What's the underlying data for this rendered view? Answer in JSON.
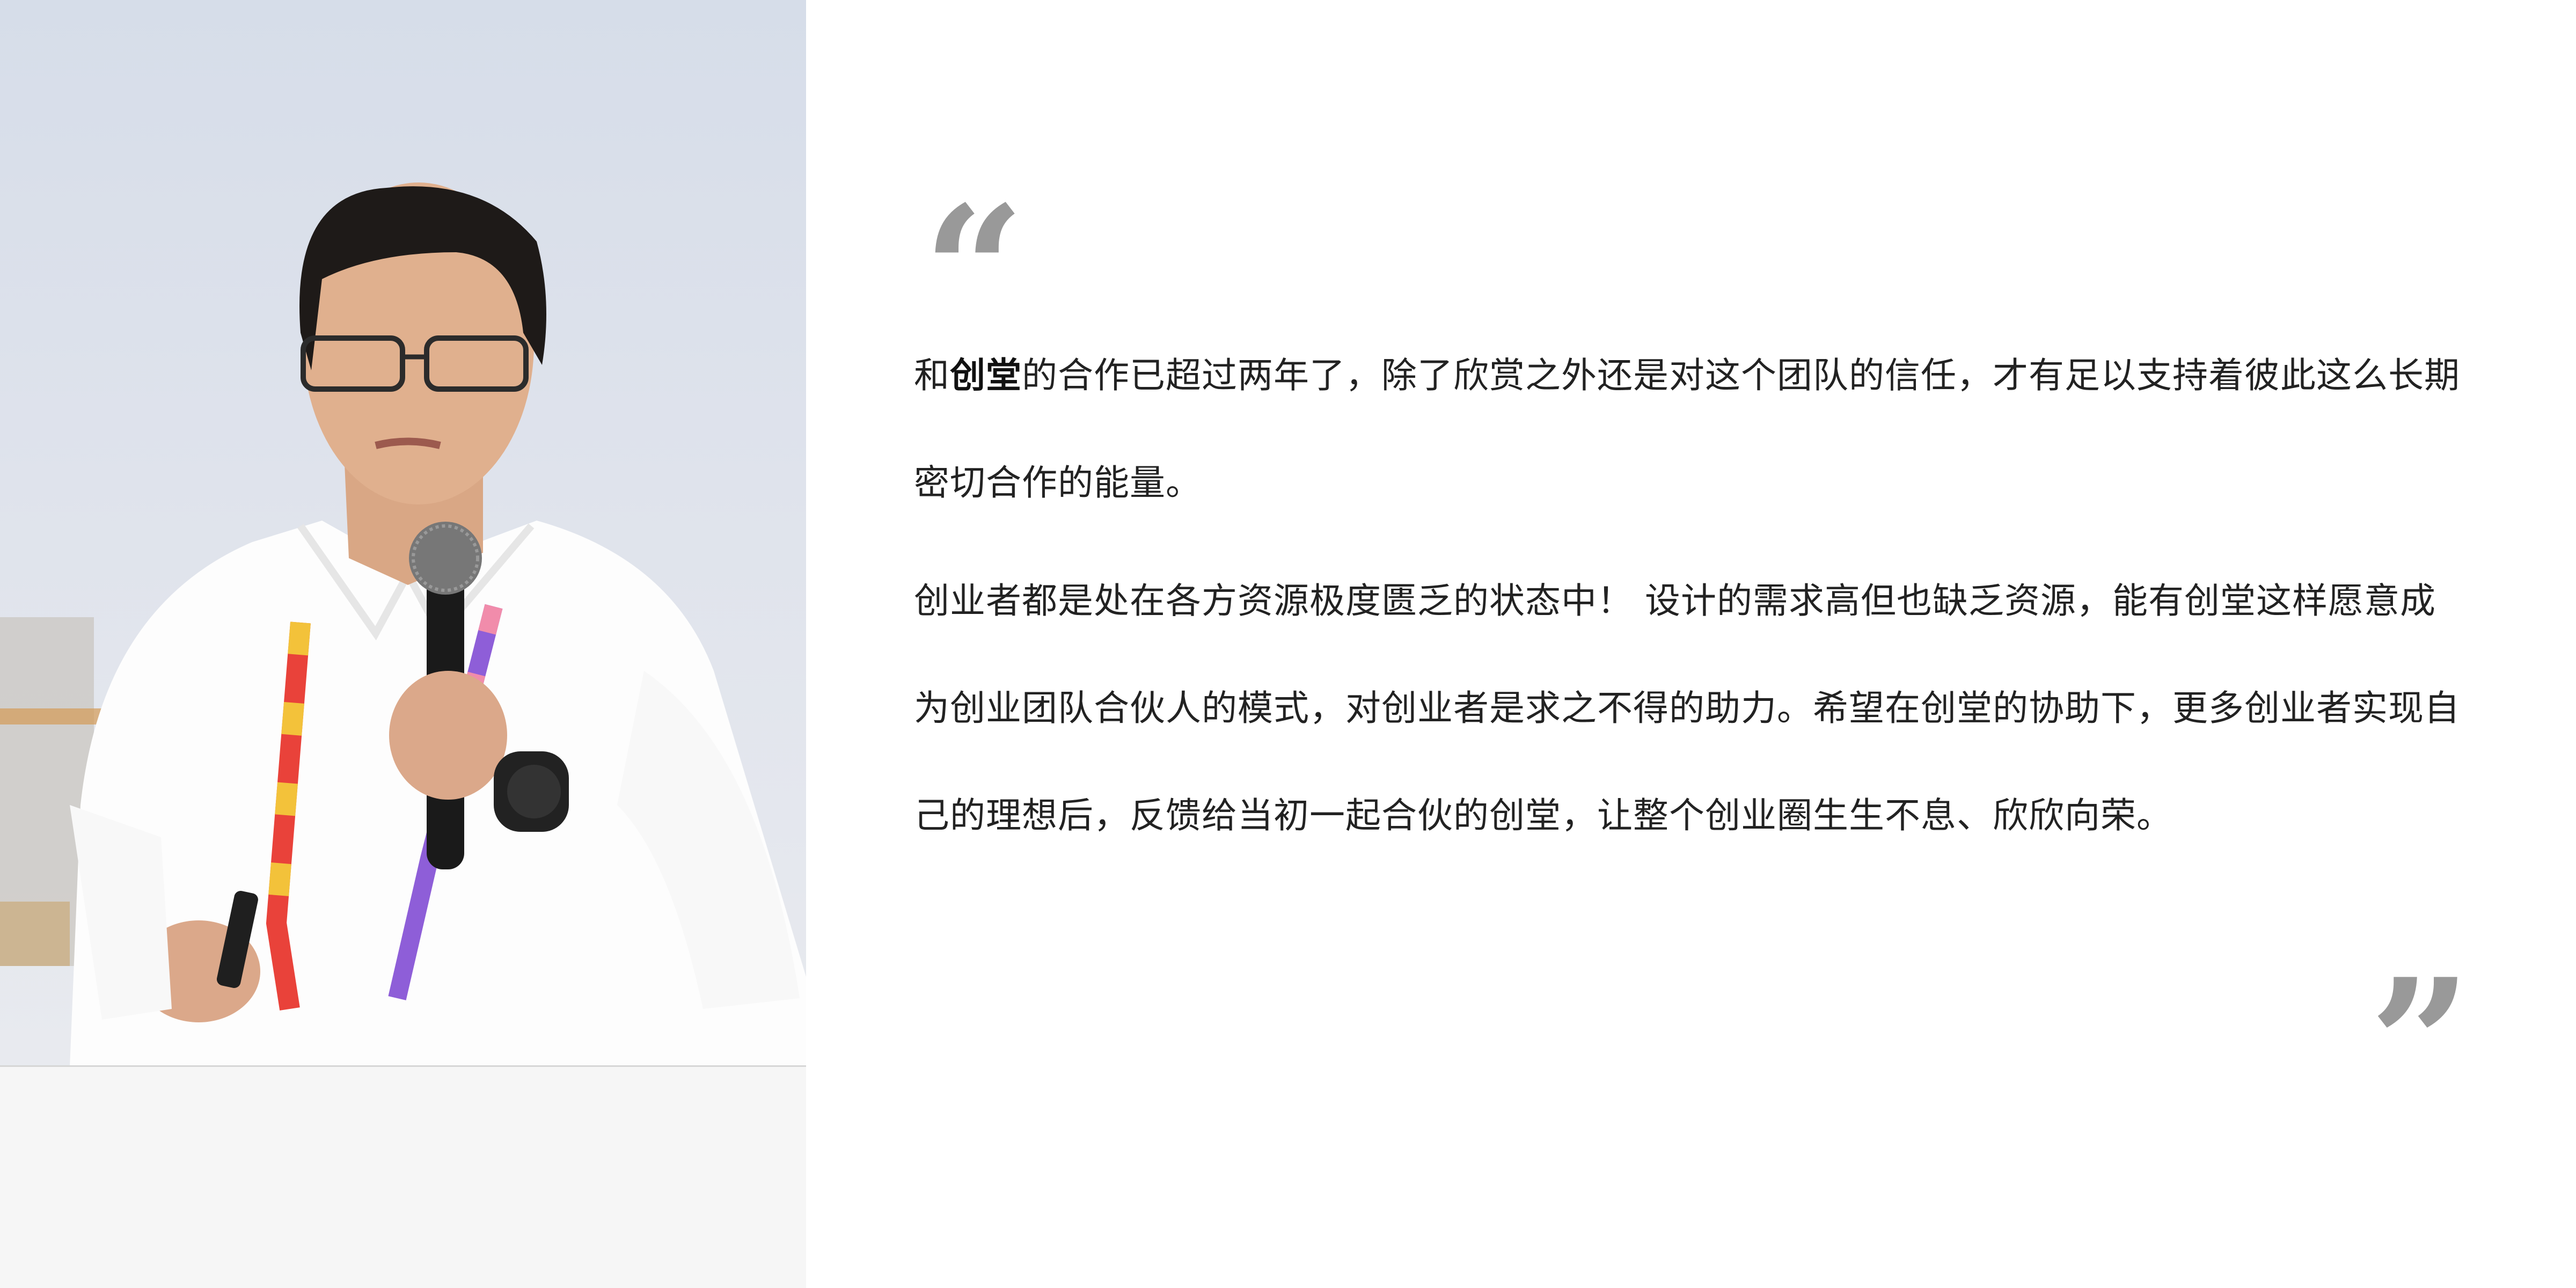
{
  "photo": {
    "alt": "speaker"
  },
  "quote": {
    "open_mark": "“",
    "close_mark": "”",
    "para1_prefix": "和",
    "para1_brand": "创堂",
    "para1_rest": "的合作已超过两年了，除了欣赏之外还是对这个团队的信任，才有足以支持着彼此这么长期密切合作的能量。",
    "para2": "创业者都是处在各方资源极度匮乏的状态中！ 设计的需求高但也缺乏资源，能有创堂这样愿意成为创业团队合伙人的模式，对创业者是求之不得的助力。希望在创堂的协助下，更多创业者实现自己的理想后，反馈给当初一起合伙的创堂，让整个创业圈生生不息、欣欣向荣。"
  },
  "colors": {
    "quote_mark": "#999999",
    "text": "#222222",
    "photo_base": "#f6f6f6"
  }
}
